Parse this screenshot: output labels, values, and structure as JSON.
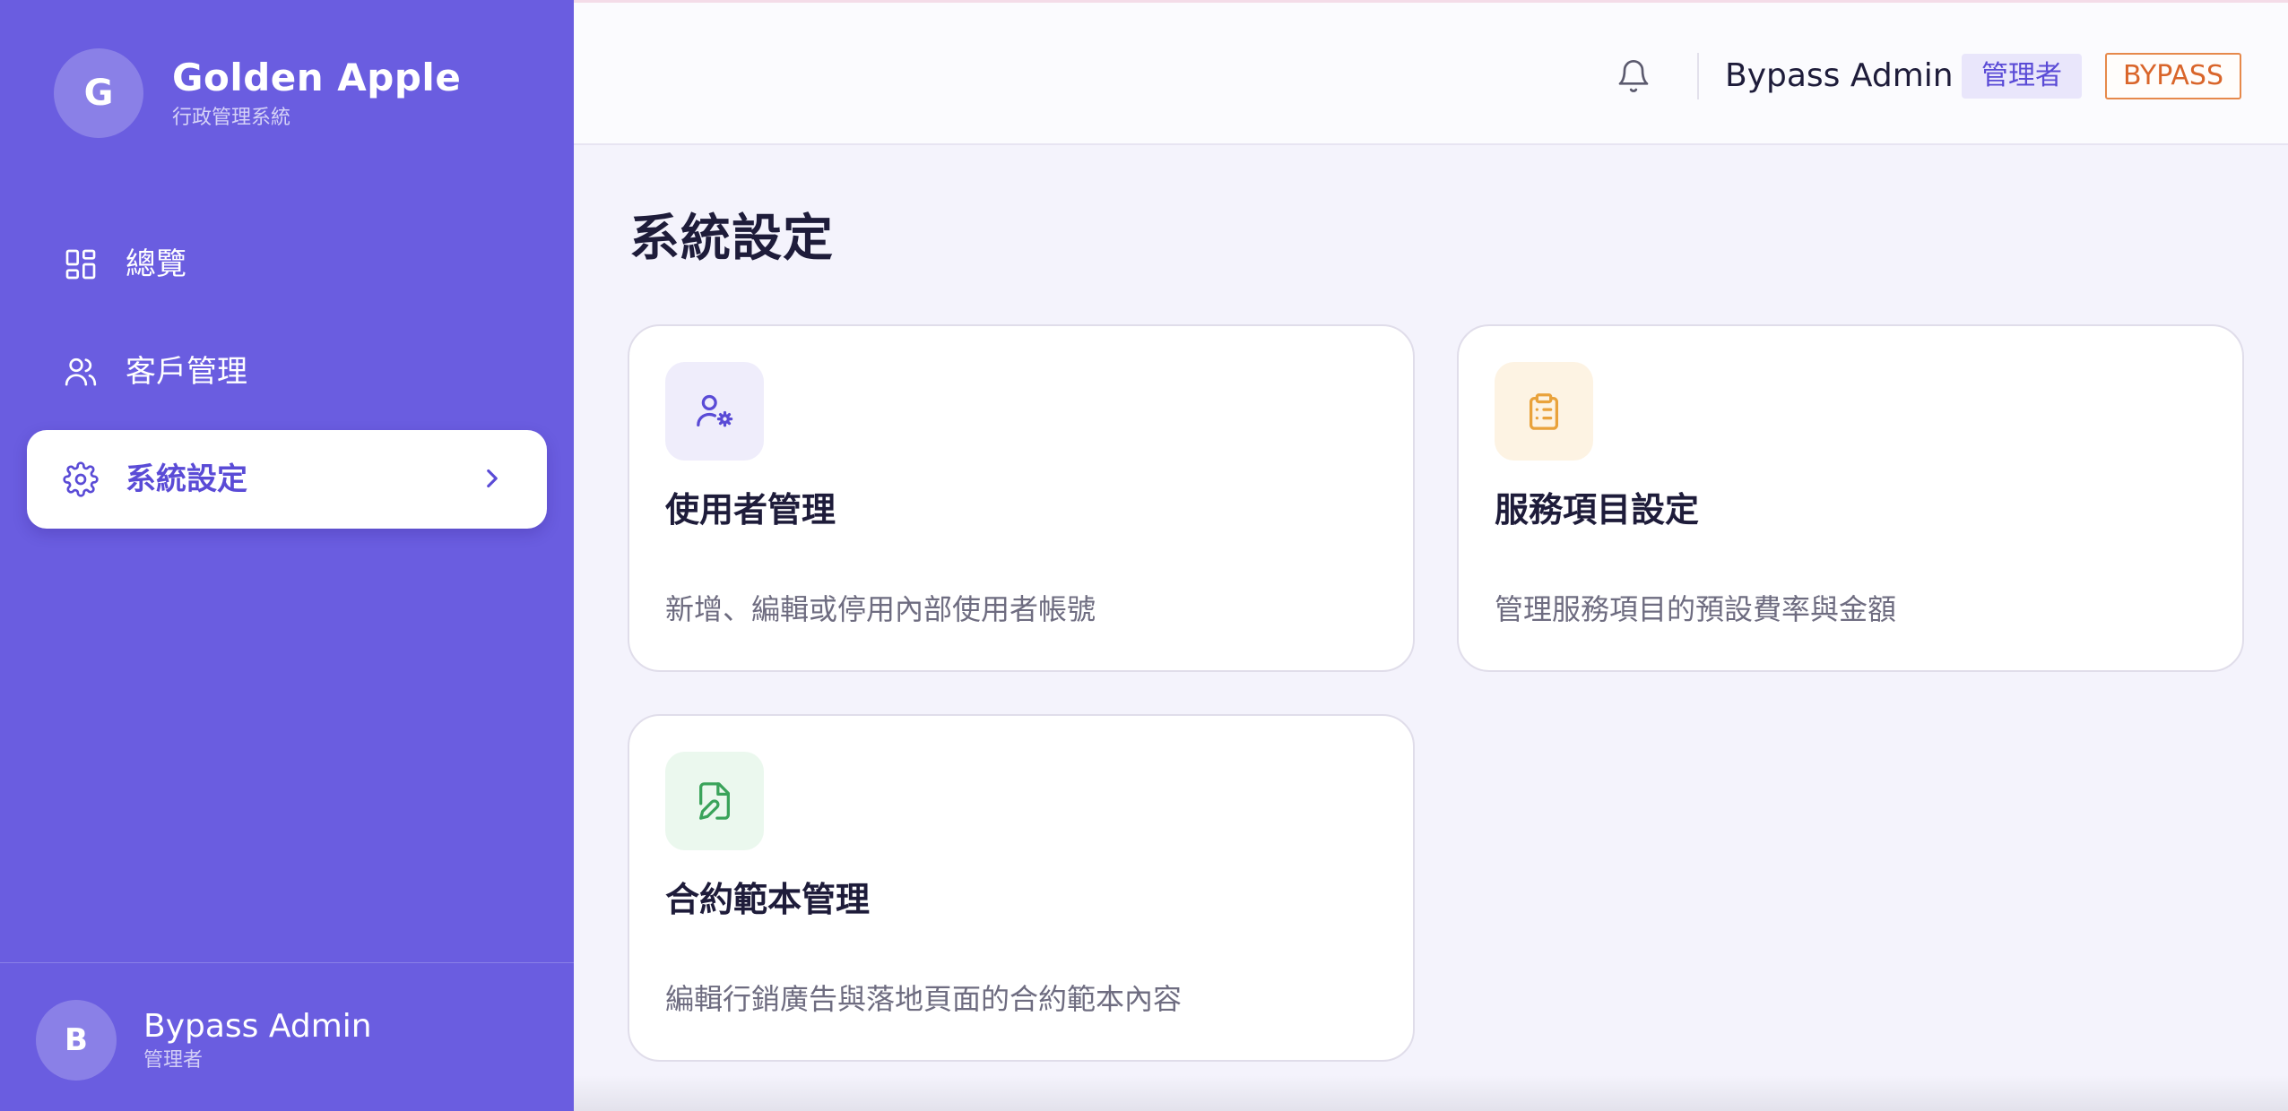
{
  "brand": {
    "initial": "G",
    "name": "Golden Apple",
    "subtitle": "行政管理系統"
  },
  "nav": {
    "items": [
      {
        "label": "總覽",
        "icon": "dashboard-icon",
        "active": false
      },
      {
        "label": "客戶管理",
        "icon": "users-icon",
        "active": false
      },
      {
        "label": "系統設定",
        "icon": "gear-icon",
        "active": true
      }
    ]
  },
  "sidebar_user": {
    "initial": "B",
    "name": "Bypass Admin",
    "role": "管理者"
  },
  "topbar": {
    "bell_icon": "bell-icon",
    "user_name": "Bypass Admin",
    "role_badge": "管理者",
    "mode_badge": "BYPASS"
  },
  "page": {
    "title": "系統設定",
    "cards": [
      {
        "title": "使用者管理",
        "description": "新增、編輯或停用內部使用者帳號",
        "icon": "user-gear-icon",
        "icon_color": "#5a4bd6",
        "icon_bg": "#efedfb"
      },
      {
        "title": "服務項目設定",
        "description": "管理服務項目的預設費率與金額",
        "icon": "clipboard-list-icon",
        "icon_color": "#e9a23b",
        "icon_bg": "#fdf3e3"
      },
      {
        "title": "合約範本管理",
        "description": "編輯行銷廣告與落地頁面的合約範本內容",
        "icon": "file-edit-icon",
        "icon_color": "#3aa35a",
        "icon_bg": "#ebf8ee"
      }
    ]
  },
  "colors": {
    "sidebar": "#6a5de0",
    "accent": "#5a4bd6",
    "background": "#f4f3fc",
    "mode_badge": "#d9652a"
  }
}
